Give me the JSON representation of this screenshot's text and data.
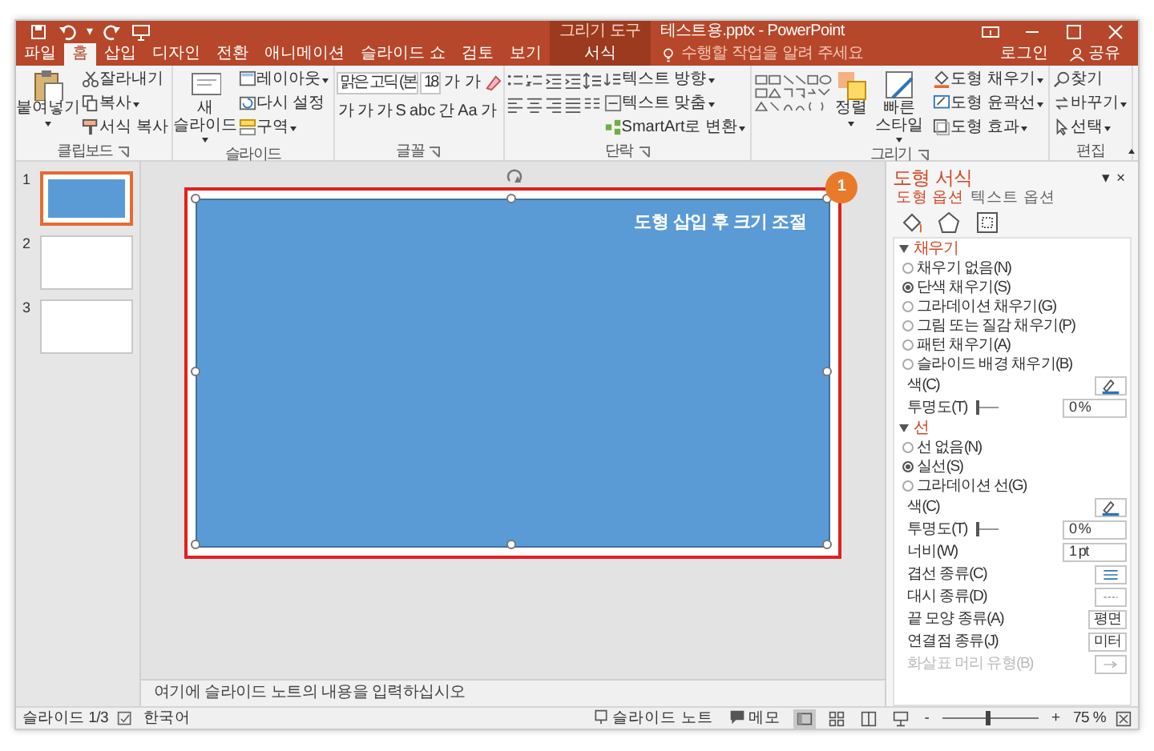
{
  "quick_access": {
    "caret": "▾"
  },
  "title_bar": {
    "title": "테스트용.pptx - PowerPoint"
  },
  "tabs": [
    {
      "label": "파일",
      "selected": false
    },
    {
      "label": "홈",
      "selected": true
    },
    {
      "label": "삽입",
      "selected": false
    },
    {
      "label": "디자인",
      "selected": false
    },
    {
      "label": "전환",
      "selected": false
    },
    {
      "label": "애니메이션",
      "selected": false
    },
    {
      "label": "슬라이드 쇼",
      "selected": false
    },
    {
      "label": "검토",
      "selected": false
    },
    {
      "label": "보기",
      "selected": false
    }
  ],
  "contextual_tab": {
    "group": "그리기 도구",
    "label": "서식",
    "selected": false
  },
  "tell_me": {
    "placeholder": "수행할 작업을 알려 주세요"
  },
  "account": {
    "sign_in": "로그인",
    "share": "공유"
  },
  "ribbon": {
    "groups": [
      {
        "kind": "standard",
        "label": "클립보드",
        "launcher": true,
        "items": [
          {
            "kind": "large",
            "label": "붙여넣기",
            "dropdown": true
          },
          {
            "kind": "small",
            "label": "잘라내기",
            "dropdown": false
          },
          {
            "kind": "small",
            "label": "복사",
            "dropdown": true
          },
          {
            "kind": "small",
            "label": "서식 복사",
            "dropdown": false
          }
        ]
      },
      {
        "kind": "standard",
        "label": "슬라이드",
        "launcher": false,
        "items": [
          {
            "kind": "large",
            "label": "새 슬라이드",
            "dropdown": true
          },
          {
            "kind": "small",
            "label": "레이아웃",
            "dropdown": true
          },
          {
            "kind": "small",
            "label": "다시 설정",
            "dropdown": false
          },
          {
            "kind": "small",
            "label": "구역",
            "dropdown": true
          }
        ]
      },
      {
        "kind": "font",
        "label": "글꼴",
        "launcher": true,
        "font_name": "맑은 고딕 (본",
        "font_size": "18",
        "size_buttons": [
          "가",
          "가"
        ],
        "format_buttons": [
          "가",
          "가",
          "가",
          "S",
          "abc",
          "간",
          "Aa",
          "가"
        ]
      },
      {
        "kind": "paragraph",
        "label": "단락",
        "launcher": true,
        "items": [
          {
            "kind": "small",
            "label": "텍스트 방향",
            "dropdown": true
          },
          {
            "kind": "small",
            "label": "텍스트 맞춤",
            "dropdown": true
          },
          {
            "kind": "small",
            "label": "SmartArt로 변환",
            "dropdown": true
          }
        ]
      },
      {
        "kind": "drawing",
        "label": "그리기",
        "launcher": true,
        "items": [
          {
            "kind": "large",
            "label": "정렬",
            "dropdown": true
          },
          {
            "kind": "large",
            "label": "빠른 스타일",
            "dropdown": true
          },
          {
            "kind": "small",
            "label": "도형 채우기",
            "dropdown": true
          },
          {
            "kind": "small",
            "label": "도형 윤곽선",
            "dropdown": true
          },
          {
            "kind": "small",
            "label": "도형 효과",
            "dropdown": true
          }
        ]
      },
      {
        "kind": "standard",
        "label": "편집",
        "launcher": false,
        "items": [
          {
            "kind": "small",
            "label": "찾기",
            "dropdown": false
          },
          {
            "kind": "small",
            "label": "바꾸기",
            "dropdown": true
          },
          {
            "kind": "small",
            "label": "선택",
            "dropdown": true
          }
        ]
      }
    ]
  },
  "slides": [
    {
      "number": "1",
      "selected": true,
      "kind": "shape"
    },
    {
      "number": "2",
      "selected": false,
      "kind": "blank"
    },
    {
      "number": "3",
      "selected": false,
      "kind": "blank"
    }
  ],
  "slide": {
    "shape_text": "도형 삽입 후 크기 조절",
    "callout": "1"
  },
  "notes": {
    "placeholder": "여기에 슬라이드 노트의 내용을 입력하십시오"
  },
  "format_pane": {
    "title": "도형 서식",
    "controls": [
      "▾",
      "×"
    ],
    "tabs": [
      {
        "label": "도형 옵션",
        "selected": true
      },
      {
        "label": "텍스트 옵션",
        "selected": false
      }
    ],
    "sections": [
      {
        "title": "채우기",
        "expanded": true,
        "options": [
          {
            "label": "채우기 없음(N)",
            "selected": false
          },
          {
            "label": "단색 채우기(S)",
            "selected": true
          },
          {
            "label": "그라데이션 채우기(G)",
            "selected": false
          },
          {
            "label": "그림 또는 질감 채우기(P)",
            "selected": false
          },
          {
            "label": "패턴 채우기(A)",
            "selected": false
          },
          {
            "label": "슬라이드 배경 채우기(B)",
            "selected": false
          }
        ],
        "fields": [
          {
            "kind": "color",
            "label": "색(C)",
            "disabled": false
          },
          {
            "kind": "slider",
            "label": "투명도(T)",
            "level": 0,
            "value": "0 %",
            "disabled": false
          }
        ]
      },
      {
        "title": "선",
        "expanded": true,
        "options": [
          {
            "label": "선 없음(N)",
            "selected": false
          },
          {
            "label": "실선(S)",
            "selected": true
          },
          {
            "label": "그라데이션 선(G)",
            "selected": false
          }
        ],
        "fields": [
          {
            "kind": "color",
            "label": "색(C)",
            "disabled": false
          },
          {
            "kind": "slider",
            "label": "투명도(T)",
            "level": 0,
            "value": "0 %",
            "disabled": false
          },
          {
            "kind": "spin",
            "label": "너비(W)",
            "value": "1 pt",
            "disabled": false
          },
          {
            "kind": "picker",
            "label": "겹선 종류(C)",
            "disabled": false
          },
          {
            "kind": "picker",
            "label": "대시 종류(D)",
            "disabled": false
          },
          {
            "kind": "dropdown",
            "label": "끝 모양 종류(A)",
            "value": "평면",
            "disabled": false
          },
          {
            "kind": "dropdown",
            "label": "연결점 종류(J)",
            "value": "미터",
            "disabled": false
          },
          {
            "kind": "picker",
            "label": "화살표 머리 유형(B)",
            "disabled": true
          }
        ]
      }
    ]
  },
  "status_bar": {
    "slide": "슬라이드 1/3",
    "language": "한국어",
    "notes": "슬라이드 노트",
    "comments": "메모",
    "views": [
      {
        "selected": true
      },
      {
        "selected": false
      },
      {
        "selected": false
      },
      {
        "selected": false
      }
    ],
    "zoom_out": "-",
    "zoom_slider": {
      "level": 0.45
    },
    "zoom_in": "+",
    "zoom": "75 %"
  }
}
